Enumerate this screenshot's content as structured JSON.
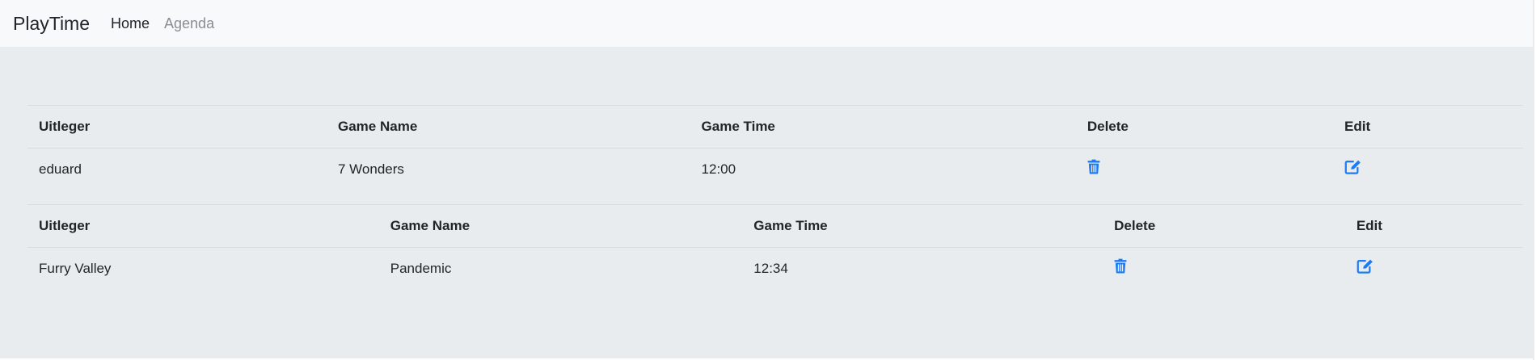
{
  "app": {
    "brand": "PlayTime"
  },
  "nav": {
    "items": [
      {
        "label": "Home"
      },
      {
        "label": "Agenda"
      }
    ]
  },
  "tables": [
    {
      "headers": {
        "uitleger": "Uitleger",
        "game_name": "Game Name",
        "game_time": "Game Time",
        "delete": "Delete",
        "edit": "Edit"
      },
      "row": {
        "uitleger": "eduard",
        "game_name": "7 Wonders",
        "game_time": "12:00"
      }
    },
    {
      "headers": {
        "uitleger": "Uitleger",
        "game_name": "Game Name",
        "game_time": "Game Time",
        "delete": "Delete",
        "edit": "Edit"
      },
      "row": {
        "uitleger": "Furry Valley",
        "game_name": "Pandemic",
        "game_time": "12:34"
      }
    }
  ],
  "icons": {
    "delete": "trash-icon",
    "edit": "edit-icon"
  },
  "colors": {
    "navbar_bg": "#f8f9fa",
    "content_bg": "#e9ecef",
    "icon_accent": "#1a7bf2"
  }
}
